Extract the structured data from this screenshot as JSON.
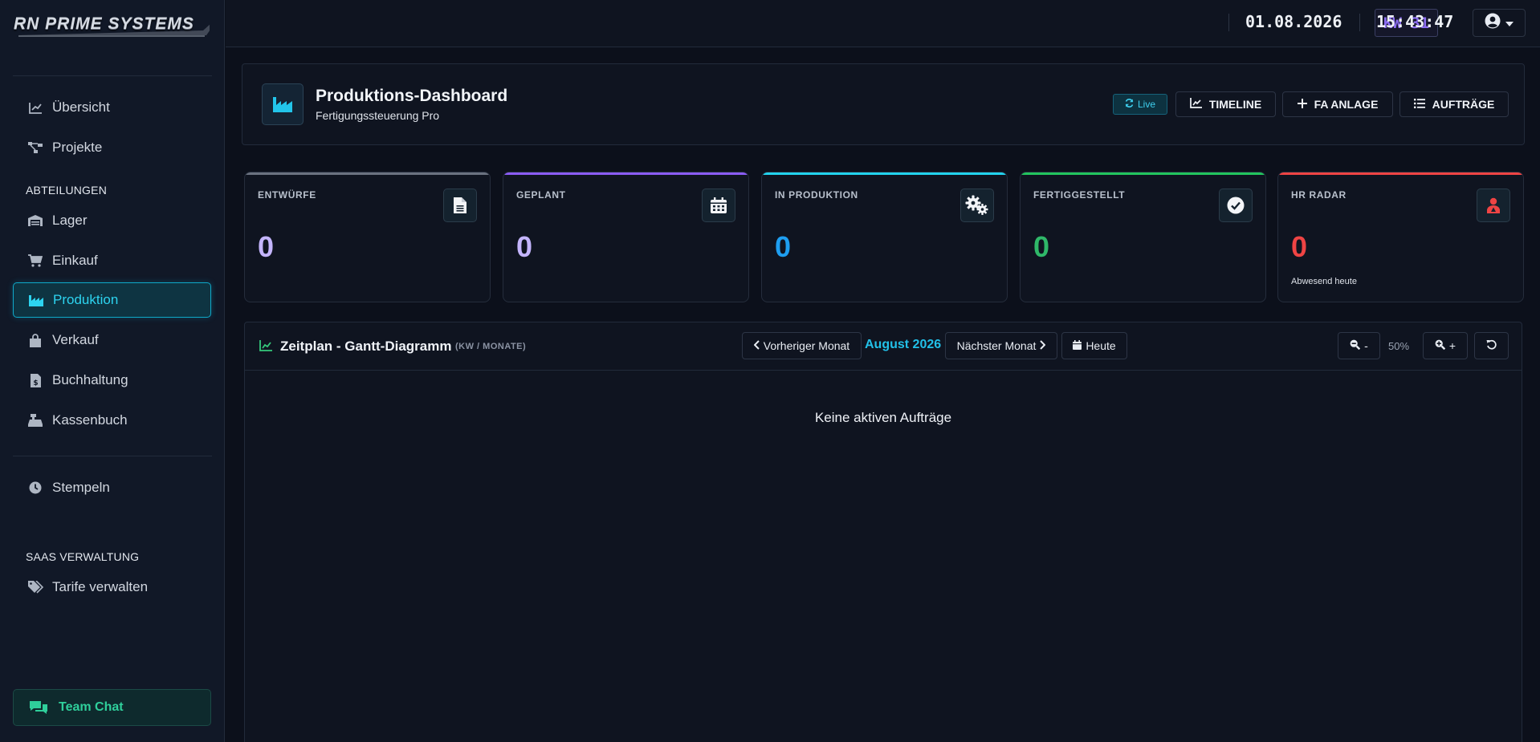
{
  "app": {
    "logo_text": "RN PRIME SYSTEMS"
  },
  "sidebar": {
    "items_top": [
      {
        "label": "Übersicht",
        "icon": "chart-line-icon"
      },
      {
        "label": "Projekte",
        "icon": "project-diagram-icon"
      }
    ],
    "section_departments": "ABTEILUNGEN",
    "departments": [
      {
        "label": "Lager",
        "icon": "warehouse-icon"
      },
      {
        "label": "Einkauf",
        "icon": "cart-icon"
      },
      {
        "label": "Produktion",
        "icon": "industry-icon",
        "active": true
      },
      {
        "label": "Verkauf",
        "icon": "shopping-bag-icon"
      },
      {
        "label": "Buchhaltung",
        "icon": "invoice-icon"
      },
      {
        "label": "Kassenbuch",
        "icon": "cash-register-icon"
      }
    ],
    "stempeln": {
      "label": "Stempeln",
      "icon": "clock-icon"
    },
    "section_saas": "SAAS VERWALTUNG",
    "saas_items": [
      {
        "label": "Tarife verwalten",
        "icon": "tags-icon"
      }
    ],
    "team_chat": {
      "label": "Team Chat",
      "icon": "comments-icon"
    }
  },
  "topbar": {
    "week": "KW 31",
    "date": "01.08.2026",
    "time": "15:43:47",
    "user_icon": "user-circle-icon"
  },
  "header": {
    "title": "Produktions-Dashboard",
    "subtitle": "Fertigungssteuerung Pro",
    "icon": "industry-icon",
    "live_label": "Live",
    "buttons": [
      {
        "label": "TIMELINE",
        "icon": "chart-area-icon"
      },
      {
        "label": "FA ANLAGE",
        "icon": "plus-icon"
      },
      {
        "label": "AUFTRÄGE",
        "icon": "list-icon"
      }
    ]
  },
  "stats": [
    {
      "label": "ENTWÜRFE",
      "value": "0",
      "icon": "file-icon",
      "color": "#c4b5fd",
      "bar": "#6b7280"
    },
    {
      "label": "GEPLANT",
      "value": "0",
      "icon": "calendar-icon",
      "color": "#c4b5fd",
      "bar": "#8b5cf6"
    },
    {
      "label": "IN PRODUKTION",
      "value": "0",
      "icon": "cogs-icon",
      "color": "#1e9ef0",
      "bar": "#22d3ee"
    },
    {
      "label": "FERTIGGESTELLT",
      "value": "0",
      "icon": "check-circle-icon",
      "color": "#2fb869",
      "bar": "#22c55e"
    },
    {
      "label": "HR RADAR",
      "value": "0",
      "icon": "user-alert-icon",
      "color": "#ef4444",
      "bar": "#ef4444",
      "footnote": "Abwesend heute"
    }
  ],
  "gantt": {
    "title": "Zeitplan - Gantt-Diagramm",
    "subtitle": "(KW / MONATE)",
    "prev_label": "Vorheriger Monat",
    "month": "August 2026",
    "next_label": "Nächster Monat",
    "today_label": "Heute",
    "zoom_out_label": "-",
    "zoom_level": "50%",
    "zoom_in_label": "+",
    "empty_message": "Keine aktiven Aufträge"
  }
}
